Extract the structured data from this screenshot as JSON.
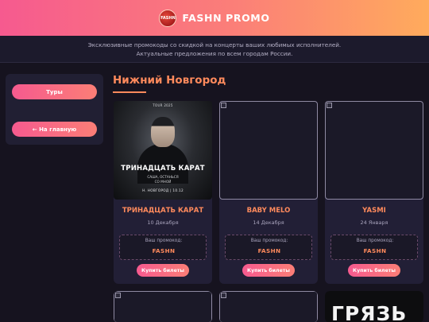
{
  "header": {
    "logo_text": "FASHN",
    "brand": "FASHN PROMO"
  },
  "subheader": {
    "line1": "Эксклюзивные промокоды со скидкой на концерты ваших любимых исполнителей.",
    "line2": "Актуальные предложения по всем городам России."
  },
  "sidebar": {
    "tours_label": "Туры",
    "home_label": "← На главную"
  },
  "main": {
    "city": "Нижний Новгород",
    "cards": [
      {
        "title": "ТРИНАДЦАТЬ КАРАТ",
        "date": "10 Декабря",
        "promo_label": "Ваш промокод:",
        "promo_code": "FASHN",
        "buy_label": "Купить билеты",
        "poster": {
          "tag": "TOUR 2025",
          "title": "ТРИНАДЦАТЬ КАРАТ",
          "subtitle_line1": "САША, ОСТАНЬСЯ",
          "subtitle_line2": "СО МНОЙ",
          "city_line": "Н. НОВГОРОД | 10.12"
        }
      },
      {
        "title": "BABY MELO",
        "date": "14 Декабря",
        "promo_label": "Ваш промокод:",
        "promo_code": "FASHN",
        "buy_label": "Купить билеты"
      },
      {
        "title": "YASMI",
        "date": "24 Января",
        "promo_label": "Ваш промокод:",
        "promo_code": "FASHN",
        "buy_label": "Купить билеты"
      }
    ],
    "partial_cards": [
      {
        "poster_text": ""
      },
      {
        "poster_text": ""
      },
      {
        "poster_text": "ГРЯЗЬ"
      }
    ]
  },
  "colors": {
    "accent_orange": "#ff8a5c",
    "gradient_pink": "#f65a8f",
    "gradient_orange": "#ffab5c",
    "background": "#16131f",
    "card": "#221f36"
  }
}
